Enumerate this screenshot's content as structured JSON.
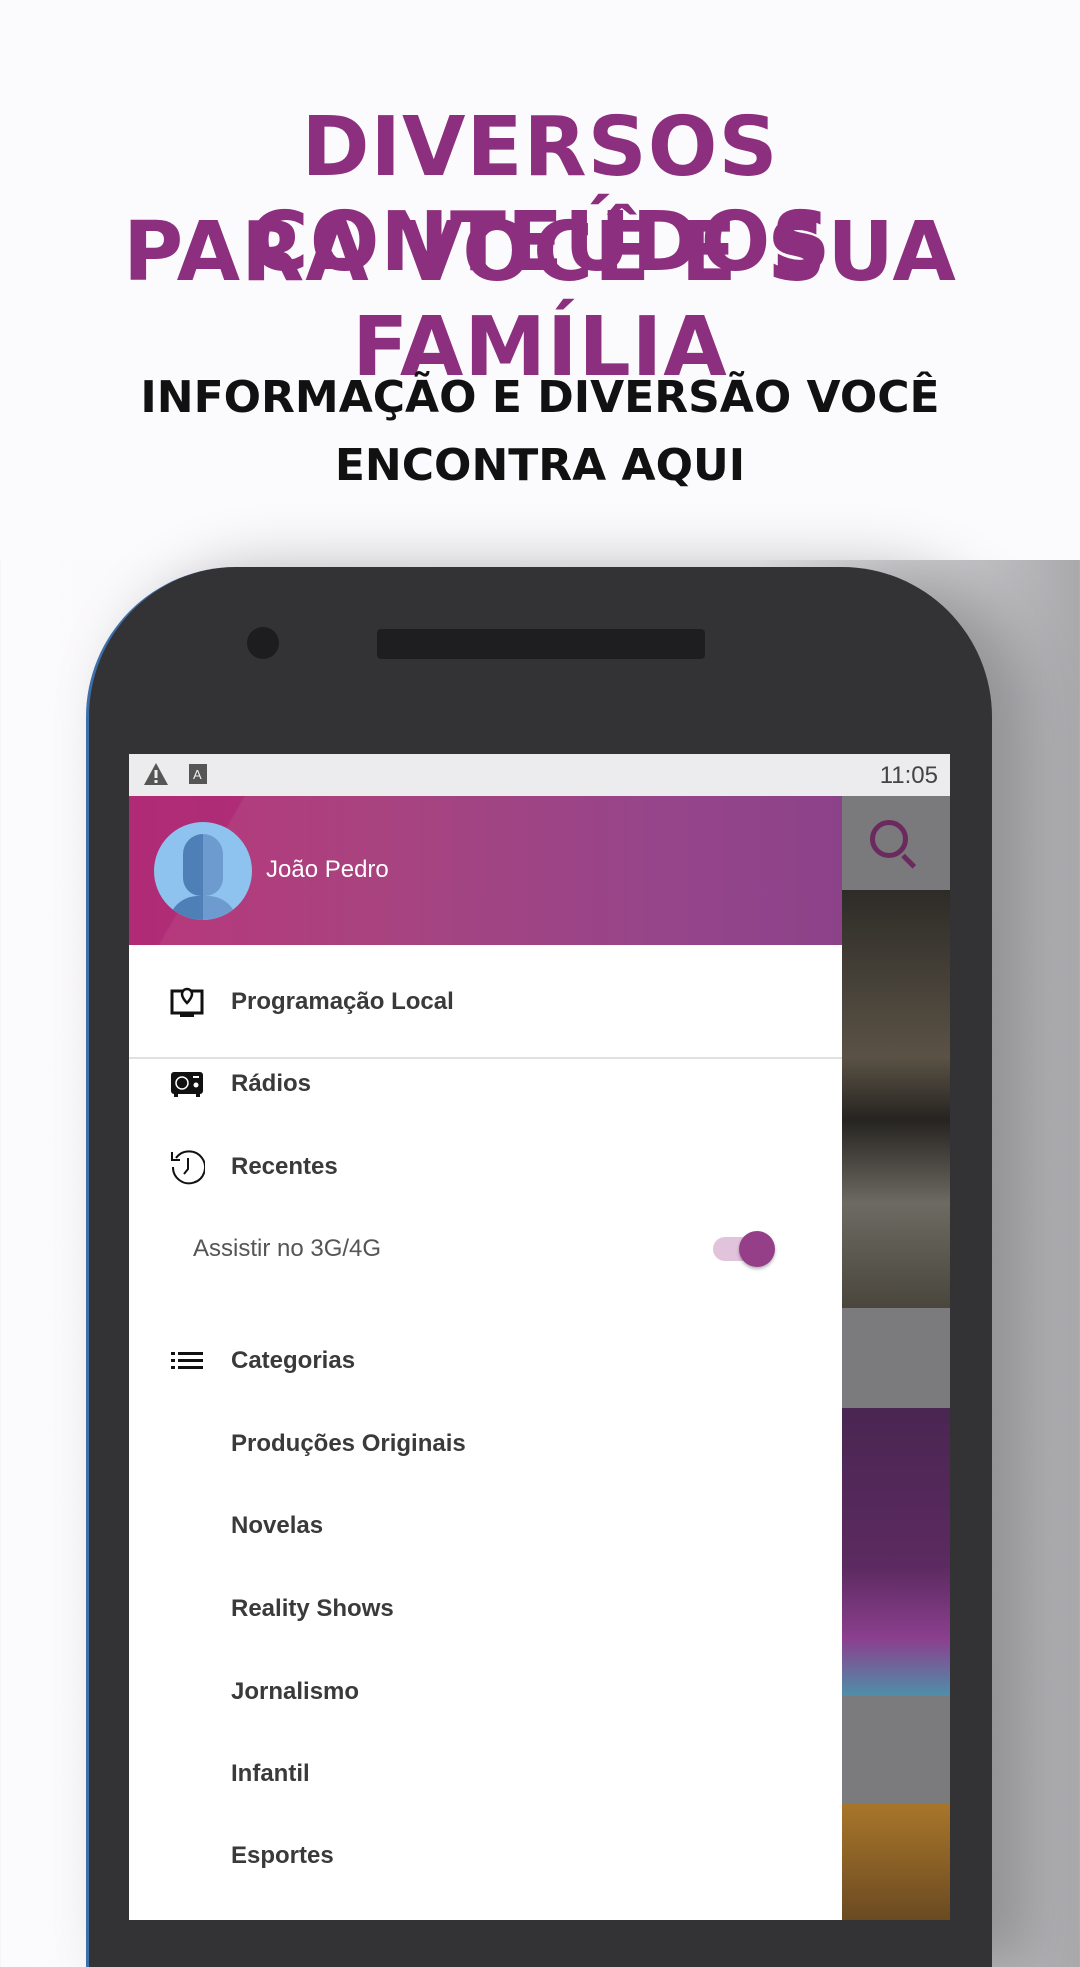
{
  "headline": {
    "line1": "DIVERSOS CONTEÚDOS",
    "line2": "PARA VOCÊ E SUA FAMÍLIA"
  },
  "subheadline": {
    "line1": "INFORMAÇÃO E DIVERSÃO VOCÊ",
    "line2": "ENCONTRA AQUI"
  },
  "status_bar": {
    "time": "11:05",
    "icons": [
      "warning-icon",
      "keyboard-a-icon"
    ]
  },
  "drawer": {
    "user_name": "João Pedro",
    "items": [
      {
        "label": "Programação Local",
        "icon": "tv-location-icon"
      },
      {
        "label": "Rádios",
        "icon": "radio-icon"
      },
      {
        "label": "Recentes",
        "icon": "history-icon"
      }
    ],
    "toggle": {
      "label": "Assistir no 3G/4G",
      "on": true
    },
    "categories": {
      "label": "Categorias",
      "icon": "list-icon",
      "items": [
        "Produções Originais",
        "Novelas",
        "Reality Shows",
        "Jornalismo",
        "Infantil",
        "Esportes"
      ]
    }
  },
  "colors": {
    "brand": "#8d2f7f",
    "accent": "#953f88"
  }
}
